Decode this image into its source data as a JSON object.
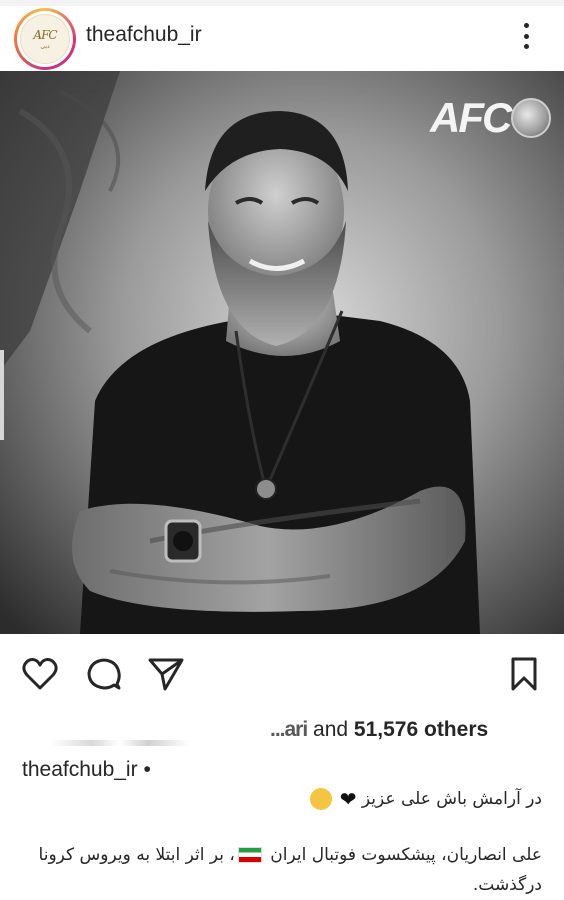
{
  "header": {
    "username": "theafchub_ir",
    "avatar_logo_text": "AFC",
    "avatar_sub_text": "دبی"
  },
  "photo": {
    "watermark_logo": "AFC"
  },
  "actions": {
    "like_icon": "heart-outline-icon",
    "comment_icon": "comment-bubble-icon",
    "share_icon": "paper-plane-icon",
    "save_icon": "bookmark-icon"
  },
  "likes": {
    "partial_name": "...ari",
    "connector": " and ",
    "count": "51,576 others"
  },
  "caption": {
    "username": "theafchub_ir",
    "bullet": "•",
    "line1_text": "در آرامش باش علی عزیز",
    "line2_text_a": "علی انصاریان، پیشکسوت فوتبال ایران",
    "line2_text_b": "، بر اثر ابتلا به ویروس کرونا درگذشت."
  },
  "colors": {
    "text": "#262626",
    "background": "#ffffff",
    "story_ring_start": "#f2c14e",
    "story_ring_end": "#c13584"
  }
}
